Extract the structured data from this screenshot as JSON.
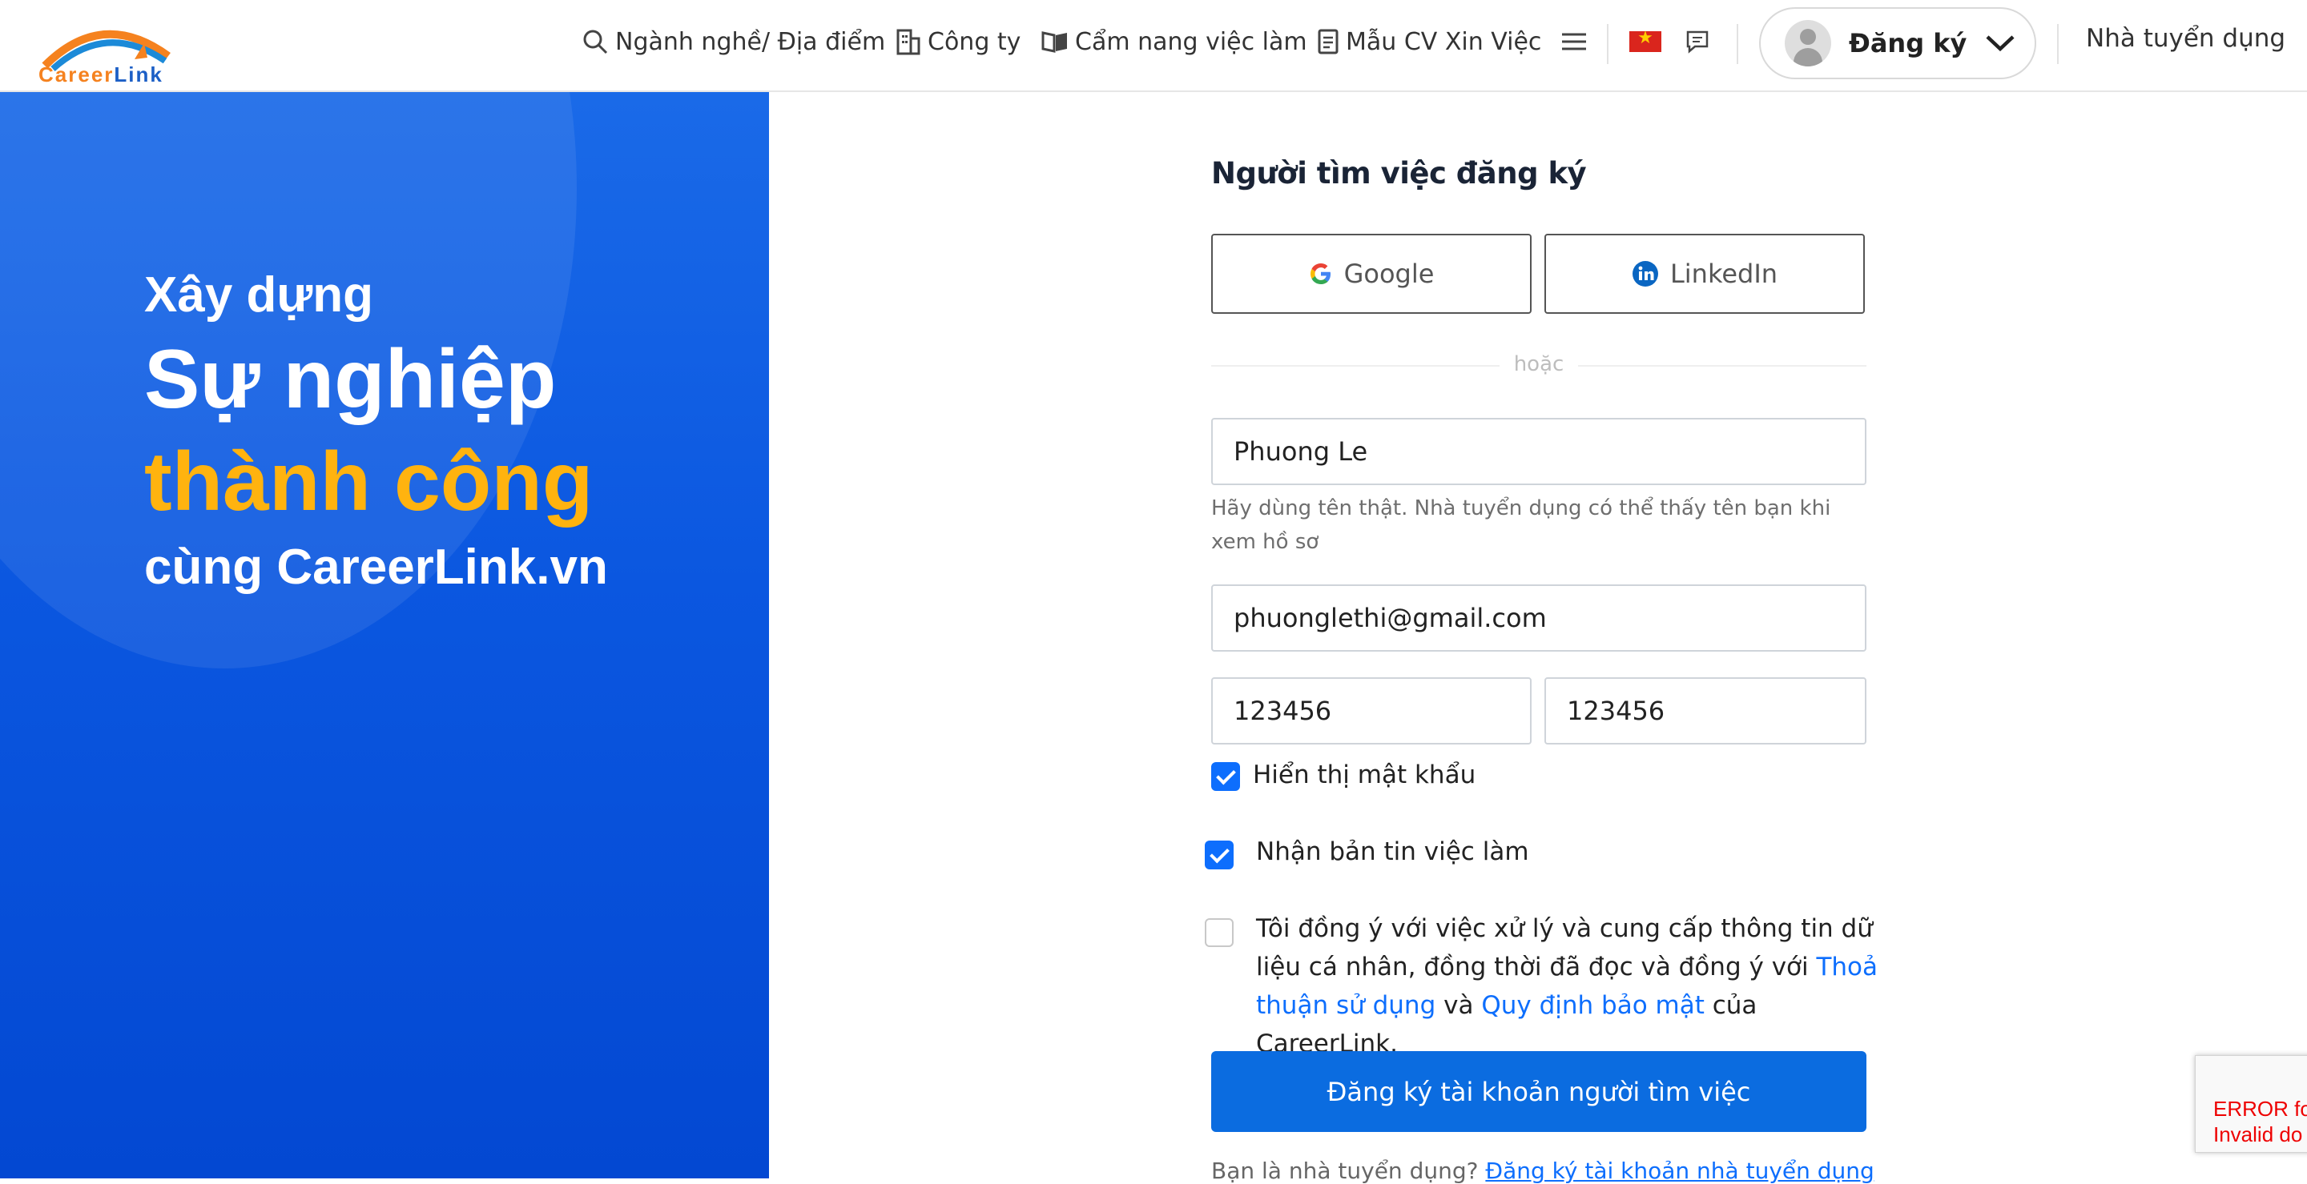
{
  "header": {
    "logo_text_a": "Career",
    "logo_text_b": "Link",
    "nav": {
      "careers": "Ngành nghề/ Địa điểm",
      "companies": "Công ty",
      "handbook": "Cẩm nang việc làm",
      "cv_templates": "Mẫu CV Xin Việc"
    },
    "signup_label": "Đăng ký",
    "employer_link": "Nhà tuyển dụng"
  },
  "hero": {
    "line1": "Xây dựng",
    "line2": "Sự nghiệp",
    "line3": "thành công",
    "line4": "cùng CareerLink.vn"
  },
  "form": {
    "title": "Người tìm việc đăng ký",
    "google_label": "Google",
    "linkedin_label": "LinkedIn",
    "or_label": "hoặc",
    "name_value": "Phuong Le",
    "name_hint": "Hãy dùng tên thật. Nhà tuyển dụng có thể thấy tên bạn khi xem hồ sơ",
    "email_value": "phuonglethi@gmail.com",
    "password_value": "123456",
    "password_confirm_value": "123456",
    "show_password_label": "Hiển thị mật khẩu",
    "newsletter_label": "Nhận bản tin việc làm",
    "terms_prefix": "Tôi đồng ý với việc xử lý và cung cấp thông tin dữ liệu cá nhân, đồng thời đã đọc và đồng ý với ",
    "terms_link": "Thoả thuận sử dụng",
    "terms_and": " và ",
    "privacy_link": "Quy định bảo mật",
    "terms_suffix": " của CareerLink.",
    "submit_label": "Đăng ký tài khoản người tìm việc",
    "bottom_text": "Bạn là nhà tuyển dụng? ",
    "bottom_link": "Đăng ký tài khoản nhà tuyển dụng"
  },
  "checkboxes": {
    "show_password": true,
    "newsletter": true,
    "terms": false
  },
  "recaptcha": {
    "line1": "ERROR fo",
    "line2": "Invalid do"
  },
  "colors": {
    "primary": "#0b6ce0",
    "hero_blue": "#0b57e0",
    "hero_accent": "#ffb30f",
    "logo_orange": "#f5821f"
  }
}
